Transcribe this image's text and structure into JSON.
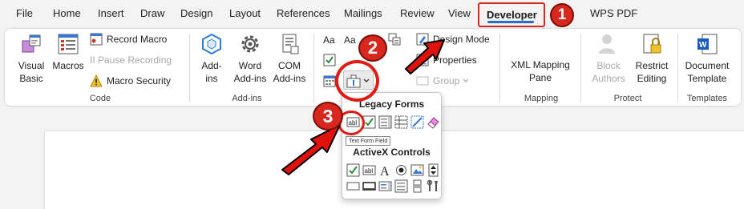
{
  "tabs": [
    "File",
    "Home",
    "Insert",
    "Draw",
    "Design",
    "Layout",
    "References",
    "Mailings",
    "Review",
    "View",
    "Developer",
    "WPS PDF"
  ],
  "active_tab": "Developer",
  "ribbon": {
    "code": {
      "label": "Code",
      "visual_basic": "Visual\nBasic",
      "macros": "Macros",
      "record_macro": "Record Macro",
      "pause_recording": "II Pause Recording",
      "macro_security": "Macro Security"
    },
    "addins": {
      "label": "Add-ins",
      "addins": "Add-\nins",
      "word_addins": "Word\nAdd-ins",
      "com_addins": "COM\nAdd-ins"
    },
    "controls": {
      "label": "",
      "design_mode": "Design Mode",
      "properties": "Properties",
      "group": "Group"
    },
    "mapping": {
      "label": "Mapping",
      "xml_mapping_pane": "XML Mapping\nPane"
    },
    "protect": {
      "label": "Protect",
      "block_authors": "Block\nAuthors",
      "restrict_editing": "Restrict\nEditing"
    },
    "templates": {
      "label": "Templates",
      "document_template": "Document\nTemplate"
    }
  },
  "dropdown": {
    "legacy_forms_title": "Legacy Forms",
    "activex_title": "ActiveX Controls",
    "tooltip": "Text Form Field"
  },
  "annotations": {
    "step1": "1",
    "step2": "2",
    "step3": "3",
    "color": "#d8271d"
  },
  "colors": {
    "accent": "#1f6fd1",
    "highlight": "#d6261f",
    "ribbon_bg": "#ffffff",
    "app_bg": "#f3f3f3"
  }
}
